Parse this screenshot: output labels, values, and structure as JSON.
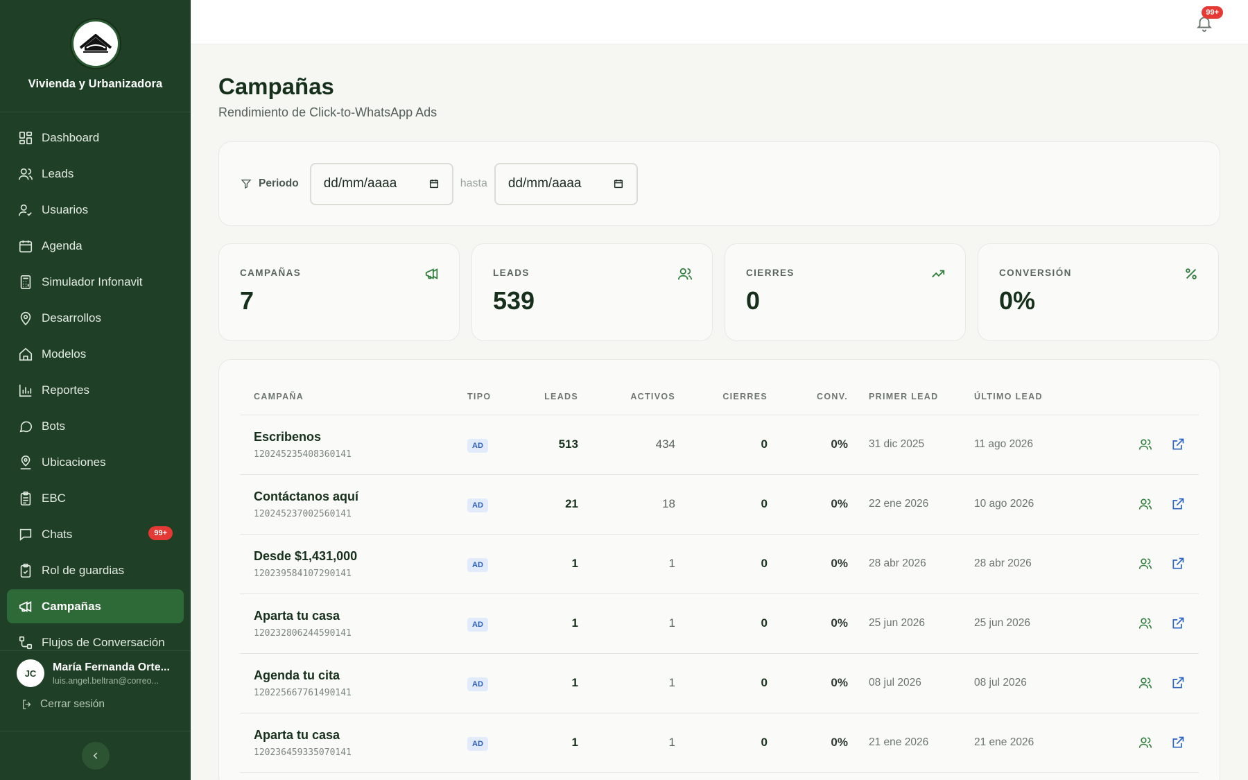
{
  "brand": {
    "name": "Vivienda y Urbanizadora"
  },
  "sidebar": {
    "items": [
      {
        "label": "Dashboard",
        "icon": "dashboard-icon"
      },
      {
        "label": "Leads",
        "icon": "users-icon"
      },
      {
        "label": "Usuarios",
        "icon": "user-check-icon"
      },
      {
        "label": "Agenda",
        "icon": "calendar-icon"
      },
      {
        "label": "Simulador Infonavit",
        "icon": "calculator-icon"
      },
      {
        "label": "Desarrollos",
        "icon": "map-pin-icon"
      },
      {
        "label": "Modelos",
        "icon": "house-icon"
      },
      {
        "label": "Reportes",
        "icon": "bar-chart-icon"
      },
      {
        "label": "Bots",
        "icon": "chat-bubble-icon"
      },
      {
        "label": "Ubicaciones",
        "icon": "user-pin-icon"
      },
      {
        "label": "EBC",
        "icon": "clipboard-icon"
      },
      {
        "label": "Chats",
        "icon": "chat-square-icon",
        "badge": "99+"
      },
      {
        "label": "Rol de guardias",
        "icon": "clipboard-check-icon"
      },
      {
        "label": "Campañas",
        "icon": "megaphone-icon",
        "active": true
      },
      {
        "label": "Flujos de Conversación",
        "icon": "workflow-icon"
      }
    ],
    "user": {
      "initials": "JC",
      "name": "María Fernanda Orte...",
      "email": "luis.angel.beltran@correo..."
    },
    "logout_label": "Cerrar sesión"
  },
  "topbar": {
    "notification_badge": "99+"
  },
  "page": {
    "title": "Campañas",
    "subtitle": "Rendimiento de Click-to-WhatsApp Ads"
  },
  "filter": {
    "label": "Periodo",
    "from_placeholder": "dd/mm/aaaa",
    "separator": "hasta",
    "to_placeholder": "dd/mm/aaaa"
  },
  "stats": [
    {
      "label": "CAMPAÑAS",
      "value": "7",
      "icon": "megaphone-icon"
    },
    {
      "label": "LEADS",
      "value": "539",
      "icon": "users-icon"
    },
    {
      "label": "CIERRES",
      "value": "0",
      "icon": "trending-up-icon"
    },
    {
      "label": "CONVERSIÓN",
      "value": "0%",
      "icon": "percent-icon"
    }
  ],
  "table": {
    "headers": [
      "CAMPAÑA",
      "TIPO",
      "LEADS",
      "ACTIVOS",
      "CIERRES",
      "CONV.",
      "PRIMER LEAD",
      "ÚLTIMO LEAD"
    ],
    "rows": [
      {
        "name": "Escribenos",
        "id": "120245235408360141",
        "tipo": "AD",
        "leads": "513",
        "activos": "434",
        "cierres": "0",
        "conv": "0%",
        "primer": "31 dic 2025",
        "ultimo": "11 ago 2026"
      },
      {
        "name": "Contáctanos aquí",
        "id": "120245237002560141",
        "tipo": "AD",
        "leads": "21",
        "activos": "18",
        "cierres": "0",
        "conv": "0%",
        "primer": "22 ene 2026",
        "ultimo": "10 ago 2026"
      },
      {
        "name": "Desde $1,431,000",
        "id": "120239584107290141",
        "tipo": "AD",
        "leads": "1",
        "activos": "1",
        "cierres": "0",
        "conv": "0%",
        "primer": "28 abr 2026",
        "ultimo": "28 abr 2026"
      },
      {
        "name": "Aparta tu casa",
        "id": "120232806244590141",
        "tipo": "AD",
        "leads": "1",
        "activos": "1",
        "cierres": "0",
        "conv": "0%",
        "primer": "25 jun 2026",
        "ultimo": "25 jun 2026"
      },
      {
        "name": "Agenda tu cita",
        "id": "120225667761490141",
        "tipo": "AD",
        "leads": "1",
        "activos": "1",
        "cierres": "0",
        "conv": "0%",
        "primer": "08 jul 2026",
        "ultimo": "08 jul 2026"
      },
      {
        "name": "Aparta tu casa",
        "id": "120236459335070141",
        "tipo": "AD",
        "leads": "1",
        "activos": "1",
        "cierres": "0",
        "conv": "0%",
        "primer": "21 ene 2026",
        "ultimo": "21 ene 2026"
      }
    ]
  },
  "colors": {
    "sidebar_bg": "#1f3f26",
    "active_item": "#2e6a38",
    "accent_green": "#2e7d3a",
    "badge_red": "#e53935",
    "ad_badge_bg": "#e1ebfb",
    "ad_badge_text": "#2c5db5"
  }
}
